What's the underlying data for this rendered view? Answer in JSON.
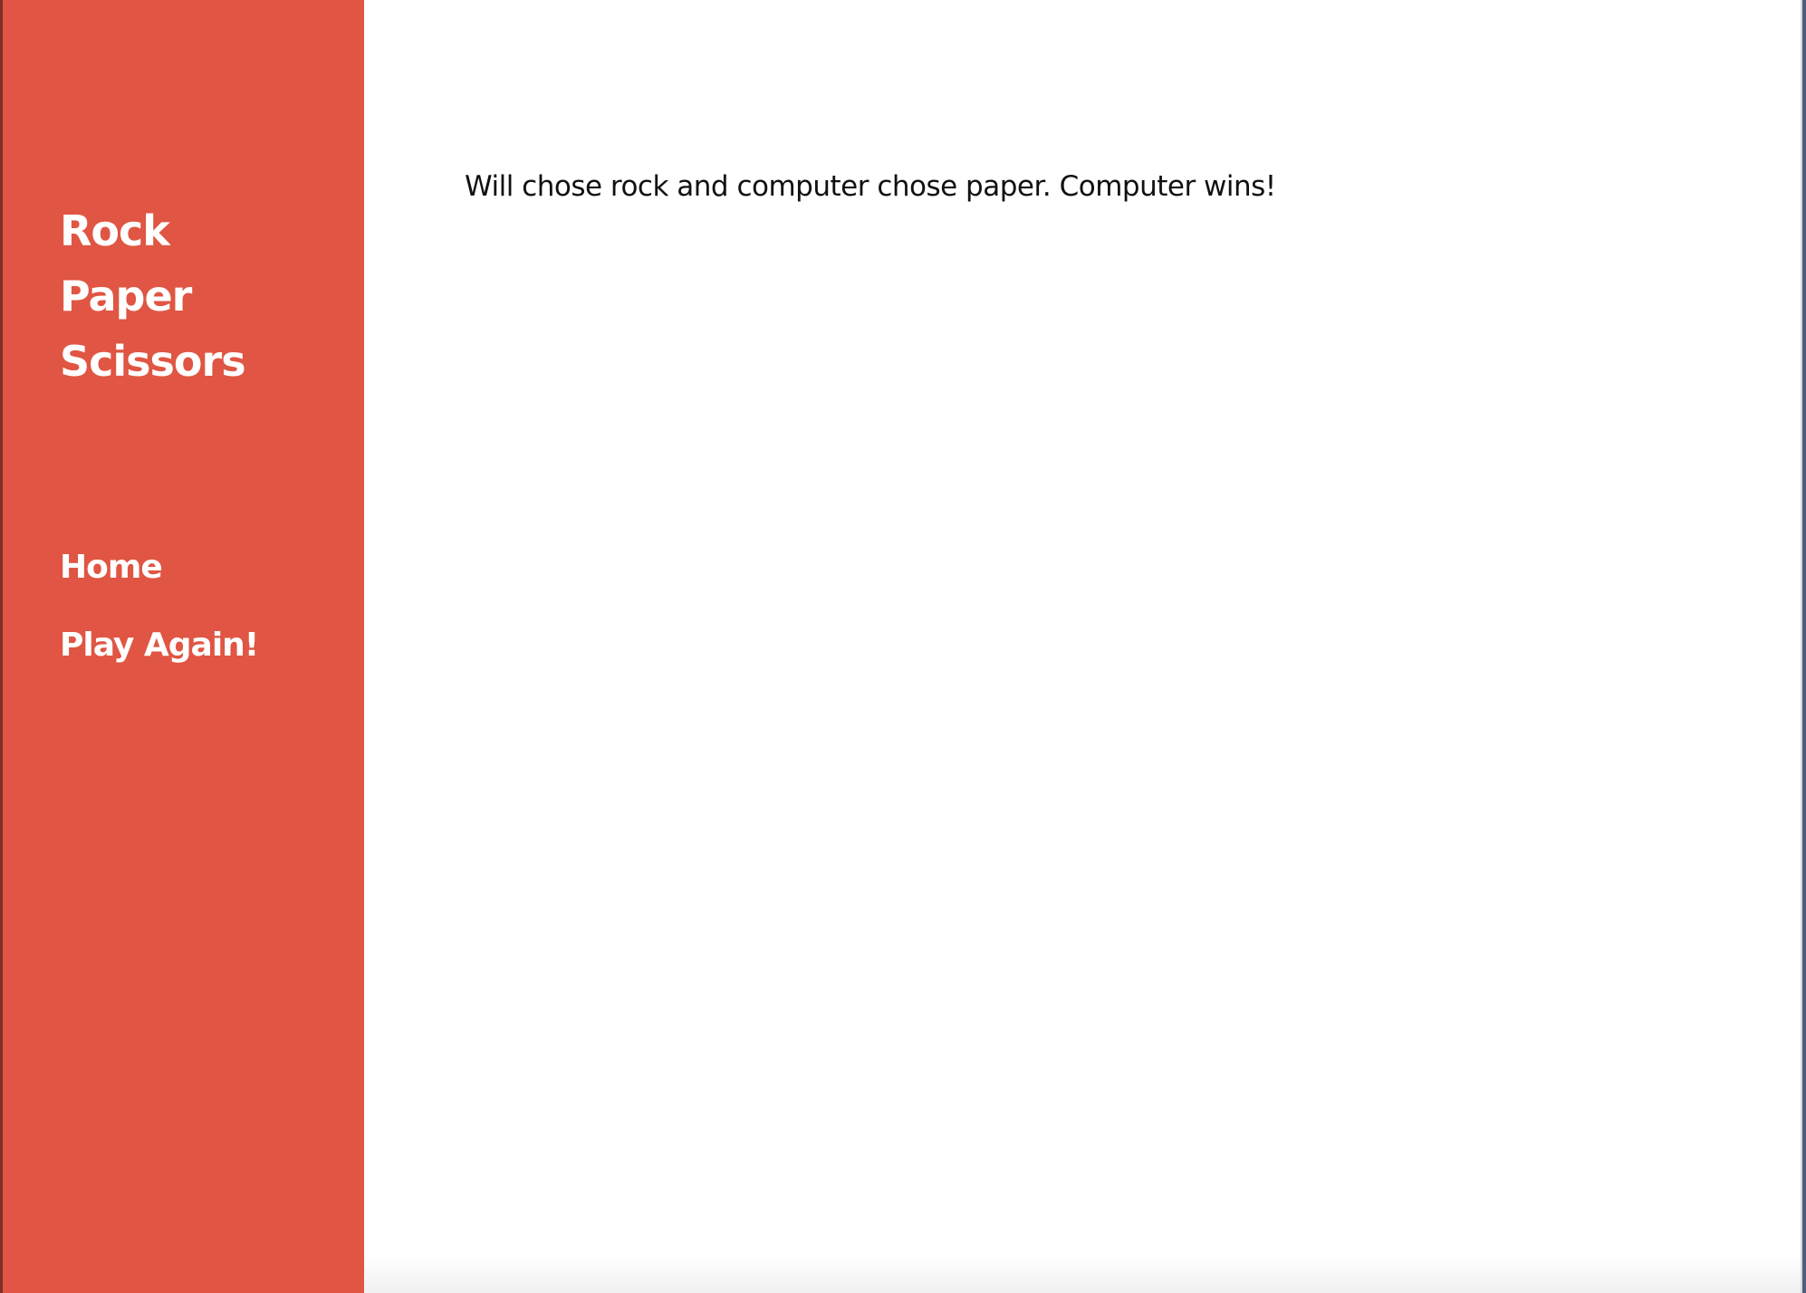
{
  "sidebar": {
    "brand_lines": [
      "Rock",
      "Paper",
      "Scissors"
    ],
    "nav": [
      {
        "label": "Home"
      },
      {
        "label": "Play Again!"
      }
    ]
  },
  "main": {
    "result_text": "Will chose rock and computer chose paper. Computer wins!"
  },
  "colors": {
    "sidebar_bg": "#e05543",
    "main_bg": "#ffffff",
    "text": "#111111",
    "desktop_bg": "#4d5f7c"
  }
}
